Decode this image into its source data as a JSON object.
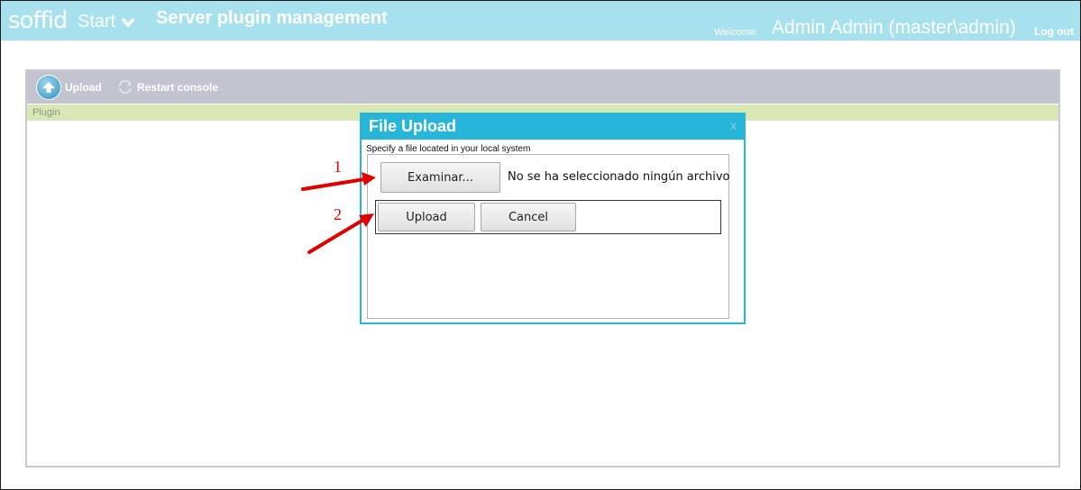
{
  "header": {
    "logo": "soffid",
    "start_label": "Start",
    "page_title": "Server plugin management",
    "welcome_label": "Welcome:",
    "user_name": "Admin Admin (master\\admin)",
    "logout_label": "Log out"
  },
  "toolbar": {
    "upload_label": "Upload",
    "restart_label": "Restart console"
  },
  "table": {
    "columns": [
      "Plugin"
    ]
  },
  "dialog": {
    "title": "File Upload",
    "close_glyph": "x",
    "instruction": "Specify a file located in your local system",
    "browse_label": "Examinar...",
    "file_status": "No se ha seleccionado ningún archivo.",
    "upload_label": "Upload",
    "cancel_label": "Cancel"
  },
  "annotations": {
    "step1": "1",
    "step2": "2",
    "arrow_color": "#e00000"
  },
  "colors": {
    "header_bg": "#a8e1ee",
    "toolbar_bg": "#c2c4cf",
    "column_header_bg": "#d8e7b4",
    "dialog_accent": "#27b6d9"
  }
}
